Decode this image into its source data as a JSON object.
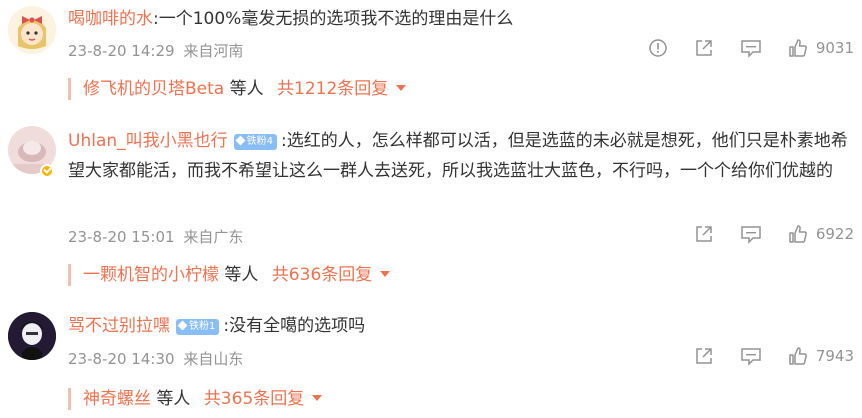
{
  "comments": [
    {
      "user": "喝咖啡的水",
      "fan_badge": "",
      "text": ":一个100%毫发无损的选项我不选的理由是什么",
      "time": "23-8-20 14:29",
      "location": "来自河南",
      "likes": "9031",
      "replies_preview": {
        "name": "修飞机的贝塔Beta",
        "suffix": "等人",
        "count": "共1212条回复"
      }
    },
    {
      "user": "Uhlan_叫我小黑也行",
      "fan_badge": "铁粉4",
      "text": ":选红的人，怎么样都可以活，但是选蓝的未必就是想死，他们只是朴素地希望大家都能活，而我不希望让这么一群人去送死，所以我选蓝壮大蓝色，不行吗，一个个给你们优越的",
      "time": "23-8-20 15:01",
      "location": "来自广东",
      "likes": "6922",
      "replies_preview": {
        "name": "一颗机智的小柠檬",
        "suffix": "等人",
        "count": "共636条回复"
      }
    },
    {
      "user": "骂不过别拉嘿",
      "fan_badge": "铁粉1",
      "text": ":没有全噶的选项吗",
      "time": "23-8-20 14:30",
      "location": "来自山东",
      "likes": "7943",
      "replies_preview": {
        "name": "神奇螺丝",
        "suffix": "等人",
        "count": "共365条回复"
      }
    }
  ],
  "colors": {
    "accent": "#eb7350",
    "meta": "#939393",
    "badge": "#89bdf5",
    "verified": "#f7b500"
  },
  "icons": [
    "report-icon",
    "share-icon",
    "comment-icon",
    "like-icon",
    "caret-down-icon"
  ]
}
